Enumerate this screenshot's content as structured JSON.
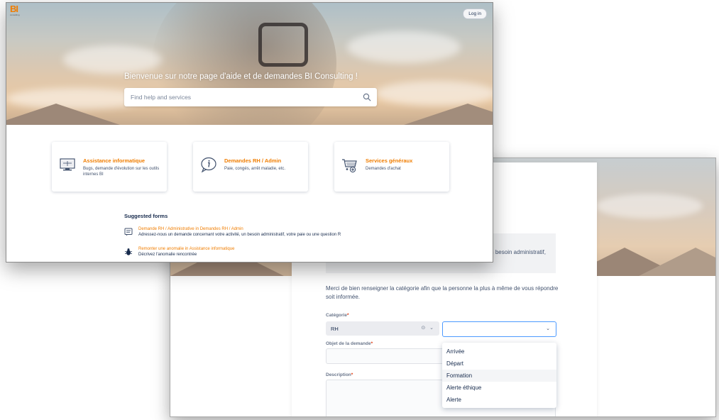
{
  "front": {
    "logo": {
      "text": "BI",
      "subtext": "consulting"
    },
    "login_label": "Log in",
    "hero_title": "Bienvenue sur notre page d'aide et de demandes BI Consulting !",
    "search": {
      "placeholder": "Find help and services",
      "icon": "search-icon"
    },
    "cards": [
      {
        "title": "Assistance informatique",
        "desc": "Bugs, demande d'évolution sur les outils internes BI",
        "icon": "computer-icon"
      },
      {
        "title": "Demandes RH / Admin",
        "desc": "Paie, congés, arrêt maladie, etc.",
        "icon": "chat-info-icon"
      },
      {
        "title": "Services généraux",
        "desc": "Demandes d'achat",
        "icon": "cart-icon"
      }
    ],
    "suggested": {
      "title": "Suggested forms",
      "items": [
        {
          "title": "Demande RH / Administrative in Demandes RH / Admin",
          "desc": "Adressez-nous un demande concernant votre activité, un besoin administratif, votre paie ou une question R",
          "icon": "form-icon"
        },
        {
          "title": "Remonter une anomalie in Assistance informatique",
          "desc": "Décrivez l'anomalie rencontrée",
          "icon": "bug-icon"
        }
      ]
    }
  },
  "back": {
    "grey_box_text": "n besoin administratif,",
    "intro": "Merci de bien renseigner la catégorie afin que la personne la plus à même de vous répondre soit informée.",
    "categorie_label": "Catégorie",
    "required_mark": "*",
    "categorie_value": "RH",
    "clear_glyph": "⊙",
    "chevron_glyph": "⌄",
    "objet_label": "Objet de la demande",
    "description_label": "Description",
    "dropdown_options": [
      "Arrivée",
      "Départ",
      "Formation",
      "Alerte éthique",
      "Alerte"
    ],
    "hovered_option": "Formation"
  },
  "colors": {
    "accent": "#f07d00",
    "focus": "#4c9aff",
    "text": "#172b4d"
  }
}
